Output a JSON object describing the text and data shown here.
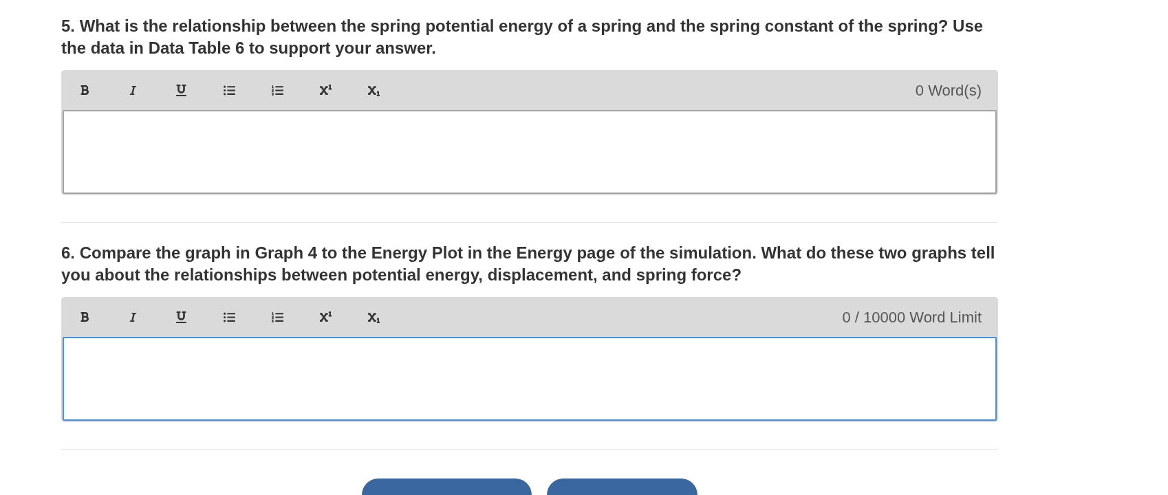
{
  "questions": [
    {
      "prompt": "5. What is the relationship between the spring potential energy of a spring and the spring constant of the spring? Use the data in Data Table 6 to support your answer.",
      "toolbar": [
        {
          "kind": "bold"
        },
        {
          "kind": "italic"
        },
        {
          "kind": "underline"
        },
        {
          "kind": "bullet_list"
        },
        {
          "kind": "numbered_list"
        },
        {
          "kind": "superscript"
        },
        {
          "kind": "subscript"
        }
      ],
      "word_count": "0 Word(s)",
      "answer": {
        "focused": false
      }
    },
    {
      "prompt": "6. Compare the graph in Graph 4 to the Energy Plot in the Energy page of the simulation. What do these two graphs tell you about the relationships between potential energy, displacement, and spring force?",
      "toolbar": [
        {
          "kind": "bold"
        },
        {
          "kind": "italic"
        },
        {
          "kind": "underline"
        },
        {
          "kind": "bullet_list"
        },
        {
          "kind": "numbered_list"
        },
        {
          "kind": "superscript"
        },
        {
          "kind": "subscript"
        }
      ],
      "word_count": "0 / 10000 Word Limit",
      "answer": {
        "focused": true
      }
    }
  ]
}
